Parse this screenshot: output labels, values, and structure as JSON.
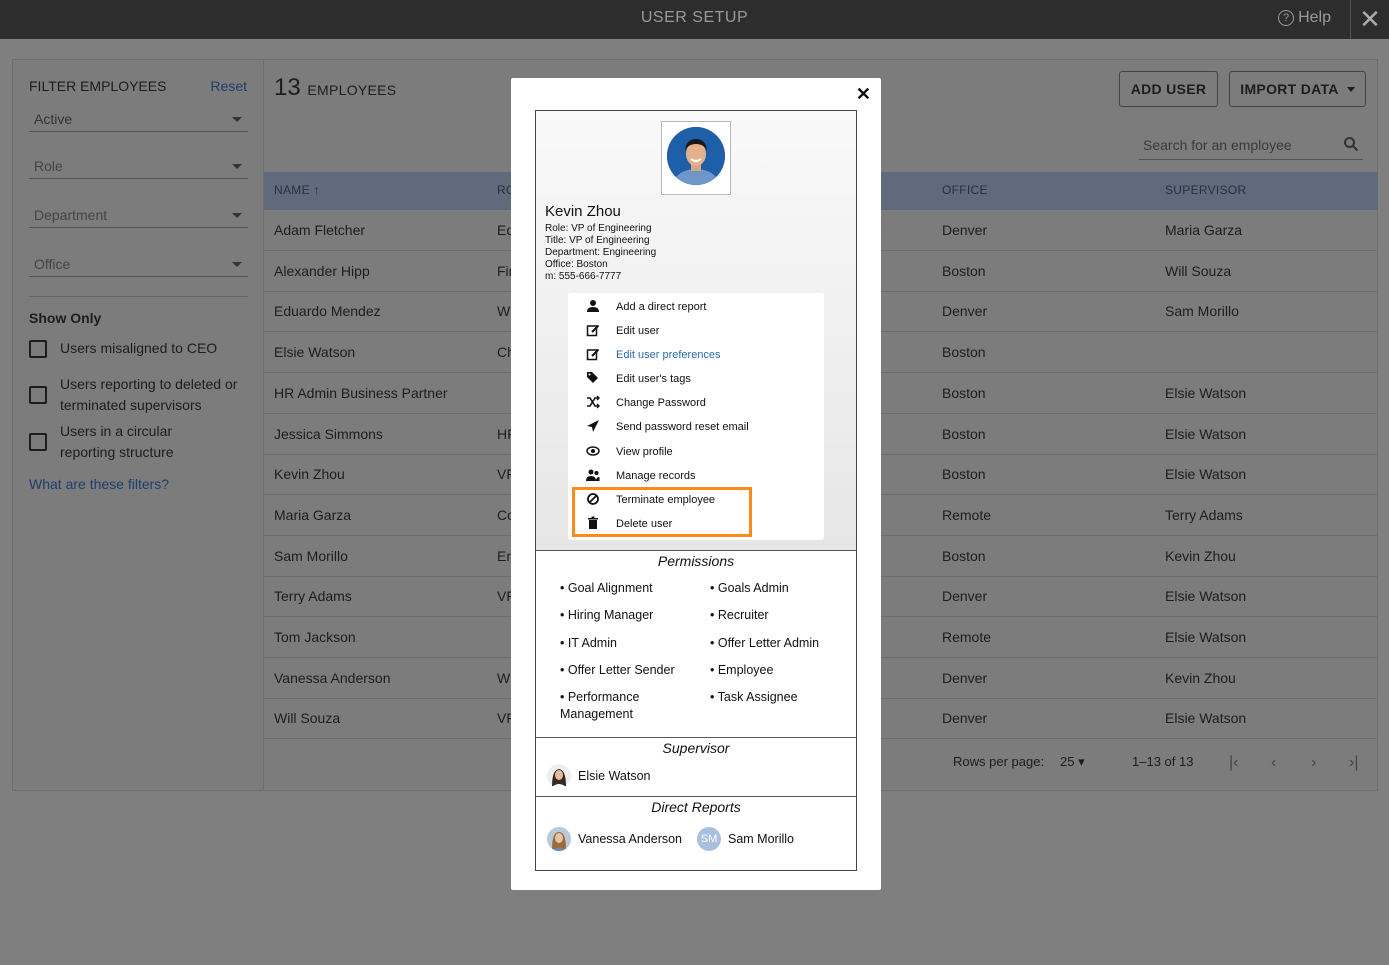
{
  "topbar": {
    "title": "USER SETUP",
    "help_label": "Help"
  },
  "sidebar": {
    "heading": "FILTER EMPLOYEES",
    "reset": "Reset",
    "status_value": "Active",
    "role_placeholder": "Role",
    "department_placeholder": "Department",
    "office_placeholder": "Office",
    "show_only": "Show Only",
    "checks": [
      "Users misaligned to CEO",
      "Users reporting to deleted or terminated supervisors",
      "Users in a circular reporting structure"
    ],
    "help_link": "What are these filters?"
  },
  "main": {
    "count": "13",
    "count_label": "EMPLOYEES",
    "add_user": "ADD USER",
    "import_data": "IMPORT DATA",
    "search_placeholder": "Search for an employee",
    "headers": {
      "name": "NAME",
      "role": "RO",
      "office": "OFFICE",
      "supervisor": "SUPERVISOR"
    },
    "rows": [
      {
        "name": "Adam Fletcher",
        "role": "Ed",
        "office": "Denver",
        "supervisor": "Maria Garza"
      },
      {
        "name": "Alexander Hipp",
        "role": "Fir",
        "office": "Boston",
        "supervisor": "Will Souza"
      },
      {
        "name": "Eduardo Mendez",
        "role": "W",
        "office": "Denver",
        "supervisor": "Sam Morillo"
      },
      {
        "name": "Elsie Watson",
        "role": "Ch",
        "office": "Boston",
        "supervisor": ""
      },
      {
        "name": "HR Admin Business Partner",
        "role": "",
        "office": "Boston",
        "supervisor": "Elsie Watson"
      },
      {
        "name": "Jessica Simmons",
        "role": "HF",
        "office": "Boston",
        "supervisor": "Elsie Watson"
      },
      {
        "name": "Kevin Zhou",
        "role": "VF",
        "office": "Boston",
        "supervisor": "Elsie Watson"
      },
      {
        "name": "Maria Garza",
        "role": "Cc",
        "office": "Remote",
        "supervisor": "Terry Adams"
      },
      {
        "name": "Sam Morillo",
        "role": "Er",
        "office": "Boston",
        "supervisor": "Kevin Zhou"
      },
      {
        "name": "Terry Adams",
        "role": "VF",
        "office": "Denver",
        "supervisor": "Elsie Watson"
      },
      {
        "name": "Tom Jackson",
        "role": "",
        "office": "Remote",
        "supervisor": "Elsie Watson"
      },
      {
        "name": "Vanessa Anderson",
        "role": "W",
        "office": "Denver",
        "supervisor": "Kevin Zhou"
      },
      {
        "name": "Will Souza",
        "role": "VF",
        "office": "Denver",
        "supervisor": "Elsie Watson"
      }
    ],
    "rows_per_page_label": "Rows per page:",
    "rows_per_page_value": "25",
    "range": "1–13 of 13"
  },
  "modal": {
    "name": "Kevin Zhou",
    "role": "Role: VP of Engineering",
    "title": "Title: VP of Engineering",
    "department": "Department: Engineering",
    "office": "Office: Boston",
    "phone": "m: 555-666-7777",
    "menu": [
      {
        "label": "Add a direct report",
        "icon": "person-icon"
      },
      {
        "label": "Edit user",
        "icon": "edit-icon"
      },
      {
        "label": "Edit user preferences",
        "icon": "edit-icon"
      },
      {
        "label": "Edit user's tags",
        "icon": "tags-icon"
      },
      {
        "label": "Change Password",
        "icon": "shuffle-icon"
      },
      {
        "label": "Send password reset email",
        "icon": "send-icon"
      },
      {
        "label": "View profile",
        "icon": "eye-icon"
      },
      {
        "label": "Manage records",
        "icon": "people-icon"
      },
      {
        "label": "Terminate employee",
        "icon": "ban-icon"
      },
      {
        "label": "Delete user",
        "icon": "trash-icon"
      }
    ],
    "permissions_title": "Permissions",
    "permissions_left": [
      "• Goal Alignment",
      "• Hiring Manager",
      "• IT Admin",
      "• Offer Letter Sender",
      "• Performance Management"
    ],
    "permissions_right": [
      "• Goals Admin",
      "• Recruiter",
      "• Offer Letter Admin",
      "• Employee",
      "• Task Assignee"
    ],
    "supervisor_title": "Supervisor",
    "supervisor_name": "Elsie Watson",
    "direct_reports_title": "Direct Reports",
    "direct_reports": [
      "Vanessa Anderson",
      "Sam Morillo"
    ],
    "sam_initials": "SM",
    "highlight_color": "#ff8a1c",
    "accent_color": "#2a6cb0"
  }
}
